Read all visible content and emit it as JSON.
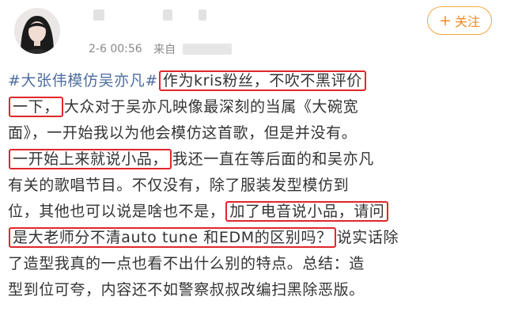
{
  "header": {
    "timestamp": "2-6 00:56",
    "source_prefix": "来自",
    "follow_plus": "+",
    "follow_label": "关注"
  },
  "post": {
    "line1": {
      "topic": "#大张伟模仿吴亦凡#",
      "hl": "作为kris粉丝，不吹不黑评价"
    },
    "line2": {
      "hl": "一下，",
      "rest": "大众对于吴亦凡映像最深刻的当属《大碗宽"
    },
    "line3": {
      "text": "面》，一开始我以为他会模仿这首歌，但是并没有。"
    },
    "line4": {
      "hl": "一开始上来就说小品，",
      "rest": "我还一直在等后面的和吴亦凡"
    },
    "line5": {
      "text": "有关的歌唱节目。不仅没有，除了服装发型模仿到"
    },
    "line6": {
      "pre": "位，其他也可以说是啥也不是，",
      "hl": "加了电音说小品，请问"
    },
    "line7": {
      "hl": "是大老师分不清auto tune 和EDM的区别吗？",
      "rest": "说实话除"
    },
    "line8": {
      "text": "了造型我真的一点也看不出什么别的特点。总结：造"
    },
    "line9": {
      "text": "型到位可夸，内容还不如警察叔叔改编扫黑除恶版。"
    }
  }
}
